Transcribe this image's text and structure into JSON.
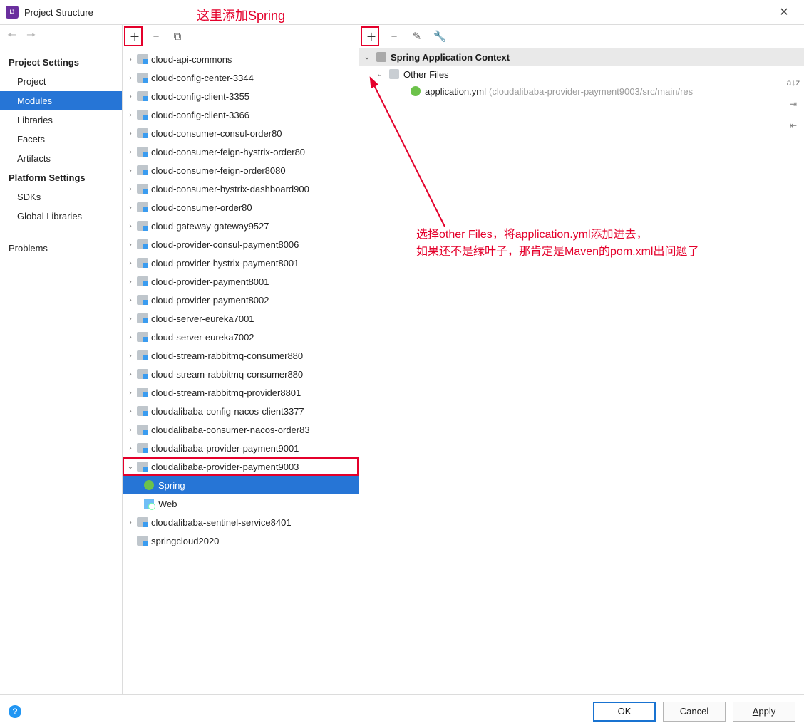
{
  "window": {
    "title": "Project Structure"
  },
  "annotations": {
    "top": "这里添加Spring",
    "right1": "选择other Files，将application.yml添加进去，",
    "right2": "如果还不是绿叶子，那肯定是Maven的pom.xml出问题了"
  },
  "sidebar": {
    "groups": [
      {
        "head": "Project Settings",
        "items": [
          "Project",
          "Modules",
          "Libraries",
          "Facets",
          "Artifacts"
        ],
        "selectedIndex": 1
      },
      {
        "head": "Platform Settings",
        "items": [
          "SDKs",
          "Global Libraries"
        ]
      }
    ],
    "problems": "Problems"
  },
  "modules": [
    "cloud-api-commons",
    "cloud-config-center-3344",
    "cloud-config-client-3355",
    "cloud-config-client-3366",
    "cloud-consumer-consul-order80",
    "cloud-consumer-feign-hystrix-order80",
    "cloud-consumer-feign-order8080",
    "cloud-consumer-hystrix-dashboard900",
    "cloud-consumer-order80",
    "cloud-gateway-gateway9527",
    "cloud-provider-consul-payment8006",
    "cloud-provider-hystrix-payment8001",
    "cloud-provider-payment8001",
    "cloud-provider-payment8002",
    "cloud-server-eureka7001",
    "cloud-server-eureka7002",
    "cloud-stream-rabbitmq-consumer880",
    "cloud-stream-rabbitmq-consumer880",
    "cloud-stream-rabbitmq-provider8801",
    "cloudalibaba-config-nacos-client3377",
    "cloudalibaba-consumer-nacos-order83",
    "cloudalibaba-provider-payment9001"
  ],
  "expandedModule": {
    "name": "cloudalibaba-provider-payment9003",
    "children": [
      {
        "label": "Spring",
        "type": "spring",
        "selected": true
      },
      {
        "label": "Web",
        "type": "web",
        "selected": false
      }
    ]
  },
  "tailModules": [
    "cloudalibaba-sentinel-service8401",
    "springcloud2020"
  ],
  "right": {
    "contextHeader": "Spring Application Context",
    "otherFiles": "Other Files",
    "file": {
      "name": "application.yml",
      "path": "(cloudalibaba-provider-payment9003/src/main/res"
    }
  },
  "footer": {
    "ok": "OK",
    "cancel": "Cancel",
    "apply": "Apply"
  }
}
